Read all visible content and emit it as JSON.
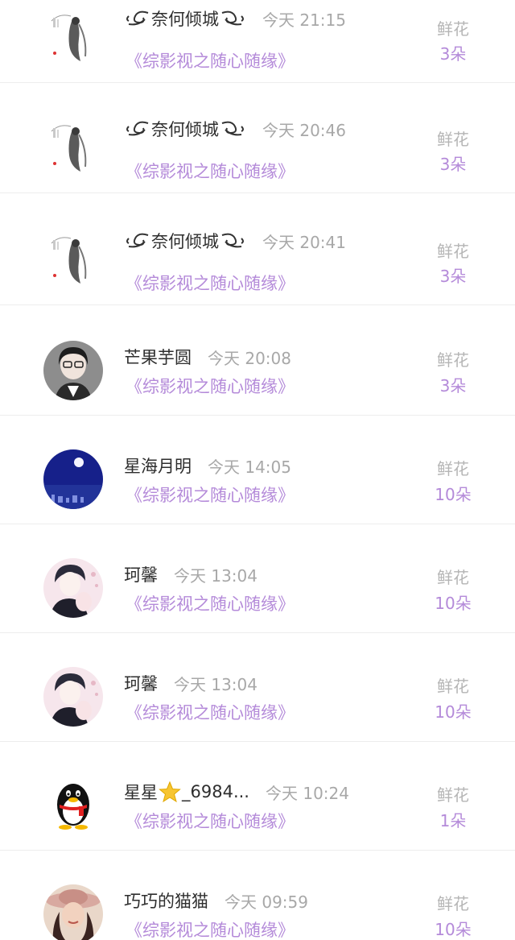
{
  "gift_list": {
    "items": [
      {
        "name": "奈何倾城",
        "time": "今天 21:15",
        "book": "《综影视之随心随缘》",
        "gift_label": "鲜花",
        "gift_count": "3朵",
        "avatar_icon": "ink-painting-lady-avatar",
        "name_icon": "flourish-icon"
      },
      {
        "name": "奈何倾城",
        "time": "今天 20:46",
        "book": "《综影视之随心随缘》",
        "gift_label": "鲜花",
        "gift_count": "3朵",
        "avatar_icon": "ink-painting-lady-avatar",
        "name_icon": "flourish-icon"
      },
      {
        "name": "奈何倾城",
        "time": "今天 20:41",
        "book": "《综影视之随心随缘》",
        "gift_label": "鲜花",
        "gift_count": "3朵",
        "avatar_icon": "ink-painting-lady-avatar",
        "name_icon": "flourish-icon"
      },
      {
        "name": "芒果芋圆",
        "time": "今天 20:08",
        "book": "《综影视之随心随缘》",
        "gift_label": "鲜花",
        "gift_count": "3朵",
        "avatar_icon": "girl-with-glasses-avatar"
      },
      {
        "name": "星海月明",
        "time": "今天 14:05",
        "book": "《综影视之随心随缘》",
        "gift_label": "鲜花",
        "gift_count": "10朵",
        "avatar_icon": "moon-sea-night-avatar"
      },
      {
        "name": "珂馨",
        "time": "今天 13:04",
        "book": "《综影视之随心随缘》",
        "gift_label": "鲜花",
        "gift_count": "10朵",
        "avatar_icon": "anime-couple-avatar"
      },
      {
        "name": "珂馨",
        "time": "今天 13:04",
        "book": "《综影视之随心随缘》",
        "gift_label": "鲜花",
        "gift_count": "10朵",
        "avatar_icon": "anime-couple-avatar"
      },
      {
        "name_prefix": "星星",
        "name_suffix": "_6984...",
        "time": "今天 10:24",
        "book": "《综影视之随心随缘》",
        "gift_label": "鲜花",
        "gift_count": "1朵",
        "avatar_icon": "qq-penguin-avatar",
        "name_icon": "star-icon"
      },
      {
        "name": "巧巧的猫猫",
        "time": "今天 09:59",
        "book": "《综影视之随心随缘》",
        "gift_label": "鲜花",
        "gift_count": "10朵",
        "avatar_icon": "woman-with-hat-avatar"
      }
    ]
  },
  "colors": {
    "name": "#2e2e2e",
    "time": "#a8a8a8",
    "accent_purple": "#b48ad9",
    "gift_label": "#b5b5b5",
    "divider": "#ededed"
  }
}
